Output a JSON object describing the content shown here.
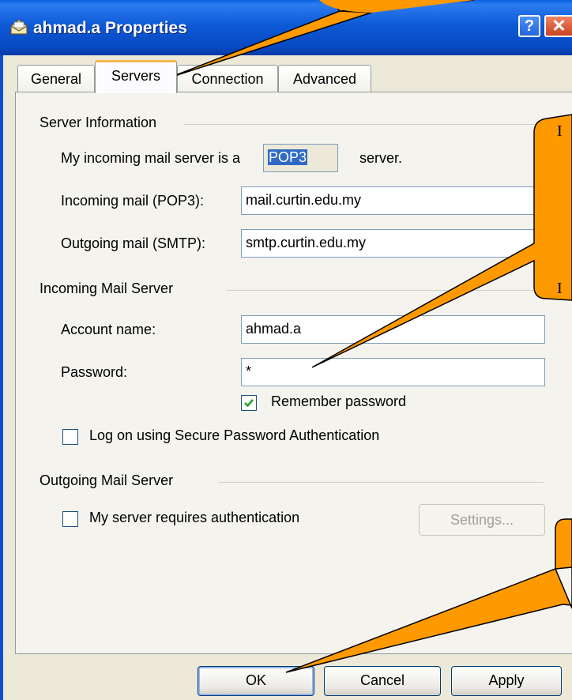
{
  "window": {
    "title": "ahmad.a Properties",
    "help_glyph": "?",
    "close_glyph": "✕",
    "icon": "mail-account-icon"
  },
  "tabs": [
    {
      "label": "General",
      "active": false
    },
    {
      "label": "Servers",
      "active": true
    },
    {
      "label": "Connection",
      "active": false
    },
    {
      "label": "Advanced",
      "active": false
    }
  ],
  "server_info": {
    "group_label": "Server Information",
    "incoming_type_prefix": "My incoming mail server is a",
    "incoming_type_value": "POP3",
    "incoming_type_suffix": "server.",
    "incoming_label": "Incoming mail (POP3):",
    "incoming_value": "mail.curtin.edu.my",
    "outgoing_label": "Outgoing mail (SMTP):",
    "outgoing_value": "smtp.curtin.edu.my"
  },
  "incoming_server": {
    "group_label": "Incoming Mail Server",
    "account_label": "Account name:",
    "account_value": "ahmad.a",
    "password_label": "Password:",
    "password_value": "*",
    "remember_label": "Remember password",
    "remember_checked": true,
    "spa_label": "Log on using Secure Password Authentication",
    "spa_checked": false
  },
  "outgoing_server": {
    "group_label": "Outgoing Mail Server",
    "auth_label": "My server requires authentication",
    "auth_checked": false,
    "settings_label": "Settings..."
  },
  "buttons": {
    "ok": "OK",
    "cancel": "Cancel",
    "apply": "Apply"
  },
  "callouts": {
    "right_letter_1": "I",
    "right_letter_2": "I",
    "fill_color": "#ff9900"
  },
  "colors": {
    "titlebar": "#0a52d8",
    "dialog_bg": "#ece9d8",
    "active_tab_accent": "#f7b64a",
    "selection": "#316ac5"
  }
}
